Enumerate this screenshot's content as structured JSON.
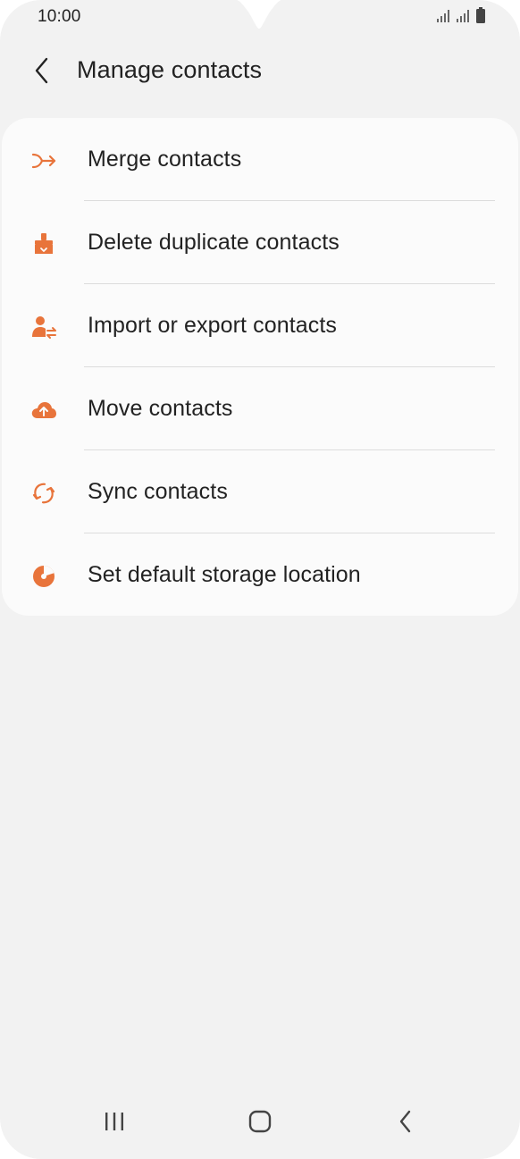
{
  "status_bar": {
    "time": "10:00",
    "icons": [
      "signal-icon",
      "signal-icon",
      "battery-icon"
    ]
  },
  "header": {
    "back_icon": "back-arrow-icon",
    "title": "Manage contacts"
  },
  "menu": {
    "items": [
      {
        "label": "Merge contacts",
        "icon": "merge-icon"
      },
      {
        "label": "Delete duplicate contacts",
        "icon": "brush-clean-icon"
      },
      {
        "label": "Import or export contacts",
        "icon": "person-transfer-icon"
      },
      {
        "label": "Move contacts",
        "icon": "cloud-upload-icon"
      },
      {
        "label": "Sync contacts",
        "icon": "sync-icon"
      },
      {
        "label": "Set default storage location",
        "icon": "storage-pie-icon"
      }
    ]
  },
  "nav_bar": {
    "icons": [
      "recent-apps-icon",
      "home-icon",
      "back-icon"
    ]
  },
  "colors": {
    "accent": "#e8743b",
    "background": "#f2f2f2",
    "card": "#fbfbfb",
    "text": "#222222",
    "divider": "#dcdcdc"
  }
}
